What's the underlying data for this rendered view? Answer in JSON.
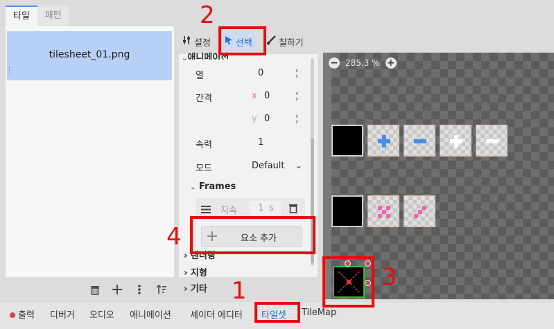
{
  "left_panel": {
    "tabs": [
      {
        "label": "타일",
        "active": true
      },
      {
        "label": "패턴",
        "active": false
      }
    ],
    "selected_file": "tilesheet_01.png",
    "bottom_icons": [
      "trash-icon",
      "plus-icon",
      "more-vertical-icon",
      "sort-icon"
    ]
  },
  "toolbar": {
    "settings_label": "설정",
    "select_label": "선택",
    "paint_label": "칠하기"
  },
  "inspector": {
    "header_section": "애니메이션",
    "rows": {
      "columns_label": "열",
      "columns_value": "0",
      "spacing_label": "간격",
      "spacing_x_axis": "x",
      "spacing_x": "0",
      "spacing_y_axis": "y",
      "spacing_y": "0",
      "speed_label": "속력",
      "speed_value": "1",
      "mode_label": "모드",
      "mode_value": "Default"
    },
    "frames_label": "Frames",
    "frame_duration_label": "지속",
    "frame_duration_value": "1",
    "frame_duration_unit": "s",
    "add_element_label": "요소 추가",
    "collapsed_sections": [
      "렌더링",
      "지형",
      "기타"
    ]
  },
  "viewer": {
    "zoom": "285.3 %"
  },
  "statusbar": {
    "items": [
      "출력",
      "디버거",
      "오디오",
      "애니메이션",
      "셰이더 에디터",
      "타일셋",
      "TileMap"
    ],
    "active": "타일셋",
    "output_status_color": "#dd4444"
  },
  "annotations": [
    "1",
    "2",
    "3",
    "4"
  ],
  "colors": {
    "accent": "#2a6fd9",
    "annotation": "#e01010",
    "selected_item": "#b7d1f6"
  }
}
